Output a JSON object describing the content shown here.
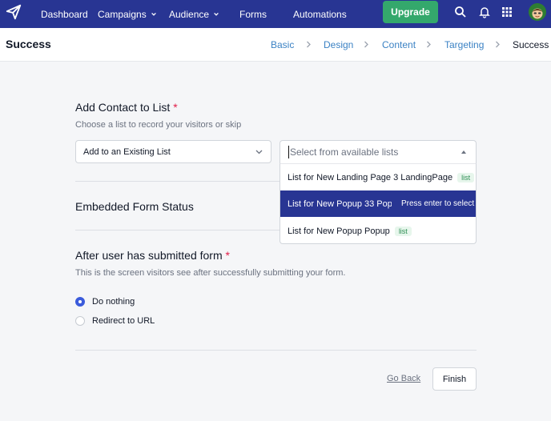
{
  "nav": {
    "items": [
      {
        "label": "Dashboard",
        "has_chevron": false
      },
      {
        "label": "Campaigns",
        "has_chevron": true
      },
      {
        "label": "Audience",
        "has_chevron": true
      },
      {
        "label": "Forms",
        "has_chevron": false
      },
      {
        "label": "Automations",
        "has_chevron": false
      }
    ],
    "upgrade_label": "Upgrade",
    "icons": [
      "logo-paper-plane-icon",
      "search-icon",
      "bell-icon",
      "apps-grid-icon",
      "avatar"
    ]
  },
  "header": {
    "title": "Success",
    "breadcrumbs": [
      "Basic",
      "Design",
      "Content",
      "Targeting",
      "Success"
    ],
    "active_step": "Success"
  },
  "contact_list": {
    "title": "Add Contact to List",
    "required_mark": "*",
    "description": "Choose a list to record your visitors or skip",
    "mode_select_value": "Add to an Existing List",
    "list_select_placeholder": "Select from available lists",
    "options": [
      {
        "label": "List for New Landing Page 3 LandingPage",
        "tag": "list"
      },
      {
        "label": "List for New Popup 33 Popup",
        "hint": "Press enter to select"
      },
      {
        "label": "List for New Popup Popup",
        "tag": "list"
      }
    ]
  },
  "embedded_form": {
    "title": "Embedded Form Status"
  },
  "after_submit": {
    "title": "After user has submitted form",
    "required_mark": "*",
    "description": "This is the screen visitors see after successfully submitting your form.",
    "options": [
      {
        "label": "Do nothing",
        "selected": true
      },
      {
        "label": "Redirect to URL",
        "selected": false
      }
    ]
  },
  "footer": {
    "back_label": "Go Back",
    "finish_label": "Finish"
  },
  "colors": {
    "nav_bg": "#283593",
    "upgrade_bg": "#34a86c",
    "link": "#3b82c4",
    "highlight": "#283593",
    "required": "#e11d48"
  }
}
